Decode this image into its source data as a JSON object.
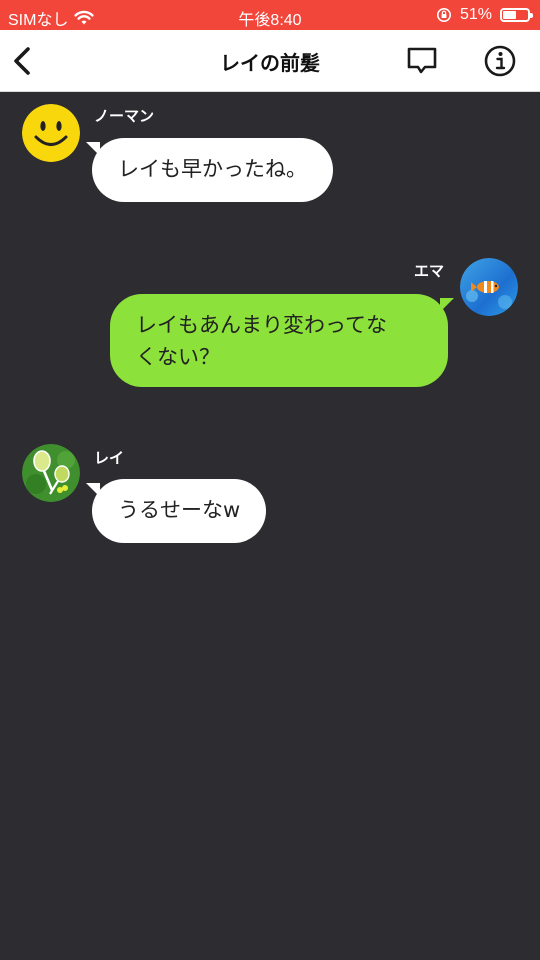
{
  "status_bar": {
    "carrier": "SIMなし",
    "time": "午後8:40",
    "battery_percent": "51%",
    "battery_level": 0.51
  },
  "header": {
    "title": "レイの前髪"
  },
  "messages": [
    {
      "sender": "ノーマン",
      "text": "レイも早かったね。",
      "side": "left"
    },
    {
      "sender": "エマ",
      "text_line1": "レイもあんまり変わってな",
      "text_line2": "くない？",
      "side": "right"
    },
    {
      "sender": "レイ",
      "text": "うるせーなw",
      "side": "left"
    }
  ],
  "icons": {
    "back": "chevron-left-icon",
    "chat": "speech-bubble-icon",
    "info": "info-icon",
    "wifi": "wifi-icon",
    "orientation_lock": "rotation-lock-icon",
    "battery": "battery-icon"
  },
  "colors": {
    "status_bar": "#f2463b",
    "background": "#2d2c30",
    "bubble_left": "#ffffff",
    "bubble_right": "#8ce13a"
  }
}
